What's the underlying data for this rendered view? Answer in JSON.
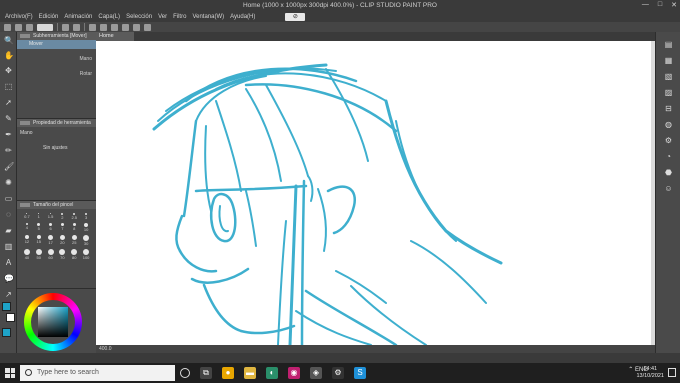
{
  "window": {
    "title": "Home (1000 x 1000px 300dpi 400.0%) - CLIP STUDIO PAINT PRO",
    "controls": [
      "—",
      "□",
      "✕"
    ]
  },
  "menu": {
    "items": [
      "Archivo(F)",
      "Edición",
      "Animación",
      "Capa(L)",
      "Selección",
      "Ver",
      "Filtro",
      "Ventana(W)",
      "Ayuda(H)"
    ],
    "warning": "⊘"
  },
  "subtool_panel": {
    "title": "Subherramienta [Mover]",
    "items": [
      {
        "label": "Mover",
        "right": ""
      },
      {
        "label": "",
        "right": "Mano"
      },
      {
        "label": "",
        "right": "Rotar"
      }
    ]
  },
  "tool_property": {
    "title": "Propiedad de herramienta",
    "tool_name": "Mano",
    "body": "Sin ajustes"
  },
  "brush_size": {
    "title": "Tamaño del pincel",
    "sizes": [
      "0.7",
      "1",
      "1.5",
      "2",
      "2.5",
      "3",
      "4",
      "5",
      "6",
      "7",
      "8",
      "10",
      "12",
      "15",
      "17",
      "20",
      "25",
      "30",
      "40",
      "50",
      "60",
      "70",
      "80",
      "100"
    ]
  },
  "document": {
    "tab": "Home",
    "zoom": "400.0"
  },
  "taskbar": {
    "search_placeholder": "Type here to search",
    "language": "ENG",
    "time": "14:41",
    "date": "13/10/2021"
  },
  "colors": {
    "stroke": "#2aa7c9",
    "main_color": "#1ea3c8",
    "sub_color": "#ffffff",
    "selected_subtool": "#6a8aa3"
  }
}
